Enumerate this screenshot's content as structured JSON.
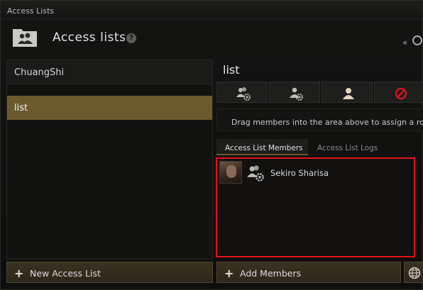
{
  "window": {
    "title": "Access Lists"
  },
  "header": {
    "title": "Access lists",
    "help_icon": "?",
    "collapse_icon": "«"
  },
  "lists": {
    "items": [
      {
        "label": "ChuangShi",
        "selected": false
      },
      {
        "label": "list",
        "selected": true
      }
    ]
  },
  "detail": {
    "title": "list",
    "role_buttons": [
      {
        "icon": "manager-role-icon"
      },
      {
        "icon": "admin-role-icon"
      },
      {
        "icon": "member-role-icon"
      },
      {
        "icon": "blocked-role-icon"
      }
    ],
    "drag_hint": "Drag members into the area above to assign a role",
    "tabs": [
      {
        "label": "Access List Members",
        "active": true
      },
      {
        "label": "Access List Logs",
        "active": false
      }
    ],
    "members": [
      {
        "name": "Sekiro Sharisa",
        "role_icon": "manager-role-icon"
      }
    ]
  },
  "footer": {
    "new_list_label": "New Access List",
    "add_members_label": "Add Members"
  },
  "colors": {
    "accent": "#6b5a2e",
    "highlight_border": "#e2121a",
    "button": "#3a3322"
  }
}
